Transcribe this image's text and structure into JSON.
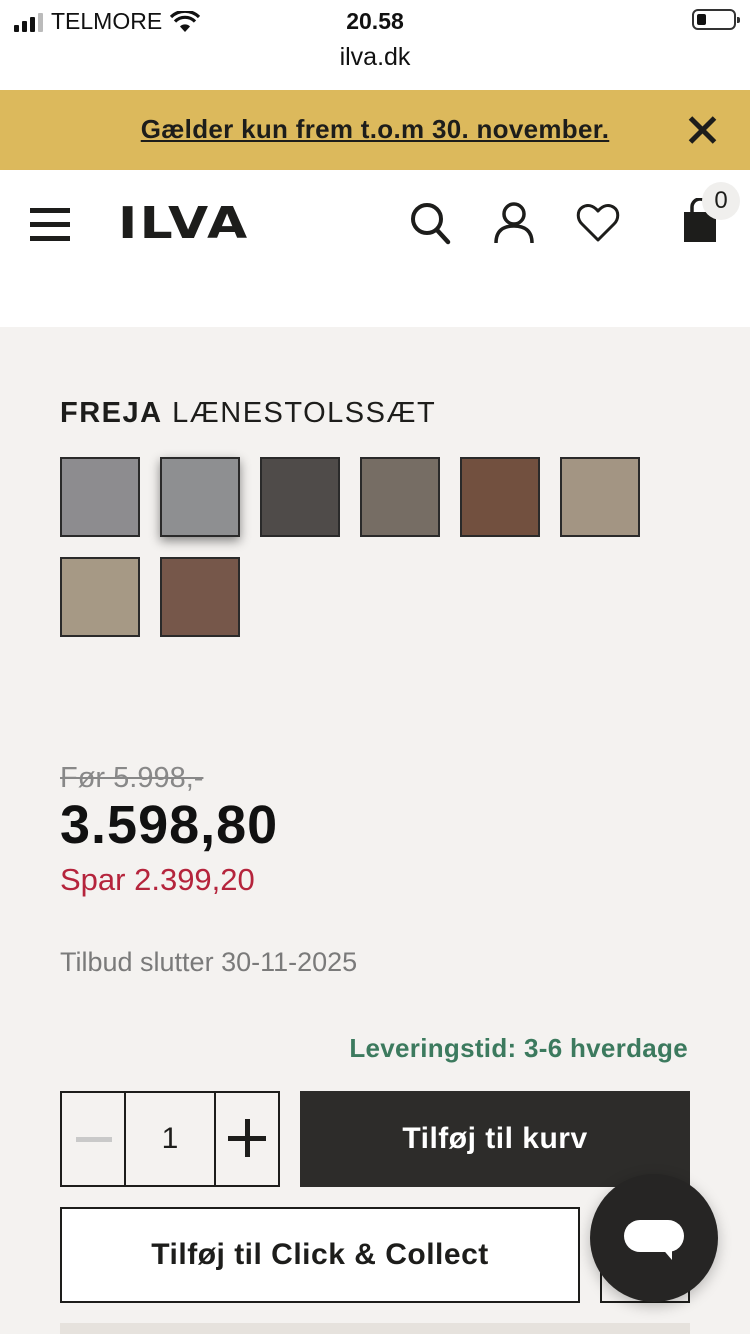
{
  "statusbar": {
    "carrier": "TELMORE",
    "time": "20.58"
  },
  "browser": {
    "url": "ilva.dk"
  },
  "promo": {
    "text": "Gælder kun frem t.o.m 30. november."
  },
  "header": {
    "logo": "ILVA",
    "cart_count": "0"
  },
  "product": {
    "name_bold": "FREJA",
    "name_rest": "LÆNESTOLSSÆT",
    "swatches": [
      {
        "color": "#8d8c8f",
        "selected": false
      },
      {
        "color": "#8e8f91",
        "selected": true
      },
      {
        "color": "#4f4b49",
        "selected": false
      },
      {
        "color": "#766d64",
        "selected": false
      },
      {
        "color": "#72503f",
        "selected": false
      },
      {
        "color": "#a39583",
        "selected": false
      },
      {
        "color": "#a69985",
        "selected": false
      },
      {
        "color": "#76574a",
        "selected": false
      }
    ],
    "old_price": "Før 5.998,-",
    "price": "3.598,80",
    "save": "Spar 2.399,20",
    "offer_end": "Tilbud slutter 30-11-2025",
    "delivery": "Leveringstid: 3-6 hverdage",
    "quantity": "1",
    "add_to_cart": "Tilføj til kurv",
    "click_collect": "Tilføj til Click & Collect"
  },
  "colors": {
    "promo_bg": "#dcb95c",
    "accent_red": "#b5243c",
    "delivery_green": "#3c7a5e",
    "dark_button": "#2d2c2a"
  }
}
